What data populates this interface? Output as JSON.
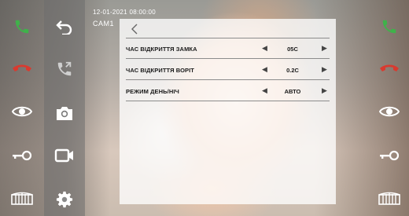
{
  "overlay": {
    "timestamp": "12-01-2021  08:00:00",
    "camera": "CAM1"
  },
  "settings": {
    "rows": [
      {
        "label": "ЧАС ВІДКРИТТЯ ЗАМКА",
        "value": "05С"
      },
      {
        "label": "ЧАС ВІДКРИТТЯ ВОРІТ",
        "value": "0.2С"
      },
      {
        "label": "РЕЖИМ ДЕНЬ/НІЧ",
        "value": "АВТО"
      }
    ]
  },
  "colors": {
    "answer_green": "#3fb24a",
    "hangup_red": "#d93a2f",
    "icon_white": "#ffffff",
    "panel_bg": "rgba(255,255,255,0.78)"
  },
  "icons": {
    "left_column": [
      "phone-answer-icon",
      "phone-hangup-icon",
      "eye-icon",
      "key-icon",
      "gate-icon"
    ],
    "tools_column": [
      "back-arrow-icon",
      "call-transfer-icon",
      "camera-icon",
      "video-record-icon",
      "settings-gear-icon"
    ],
    "right_column": [
      "phone-answer-icon",
      "phone-hangup-icon",
      "eye-icon",
      "key-icon",
      "gate-icon"
    ]
  }
}
